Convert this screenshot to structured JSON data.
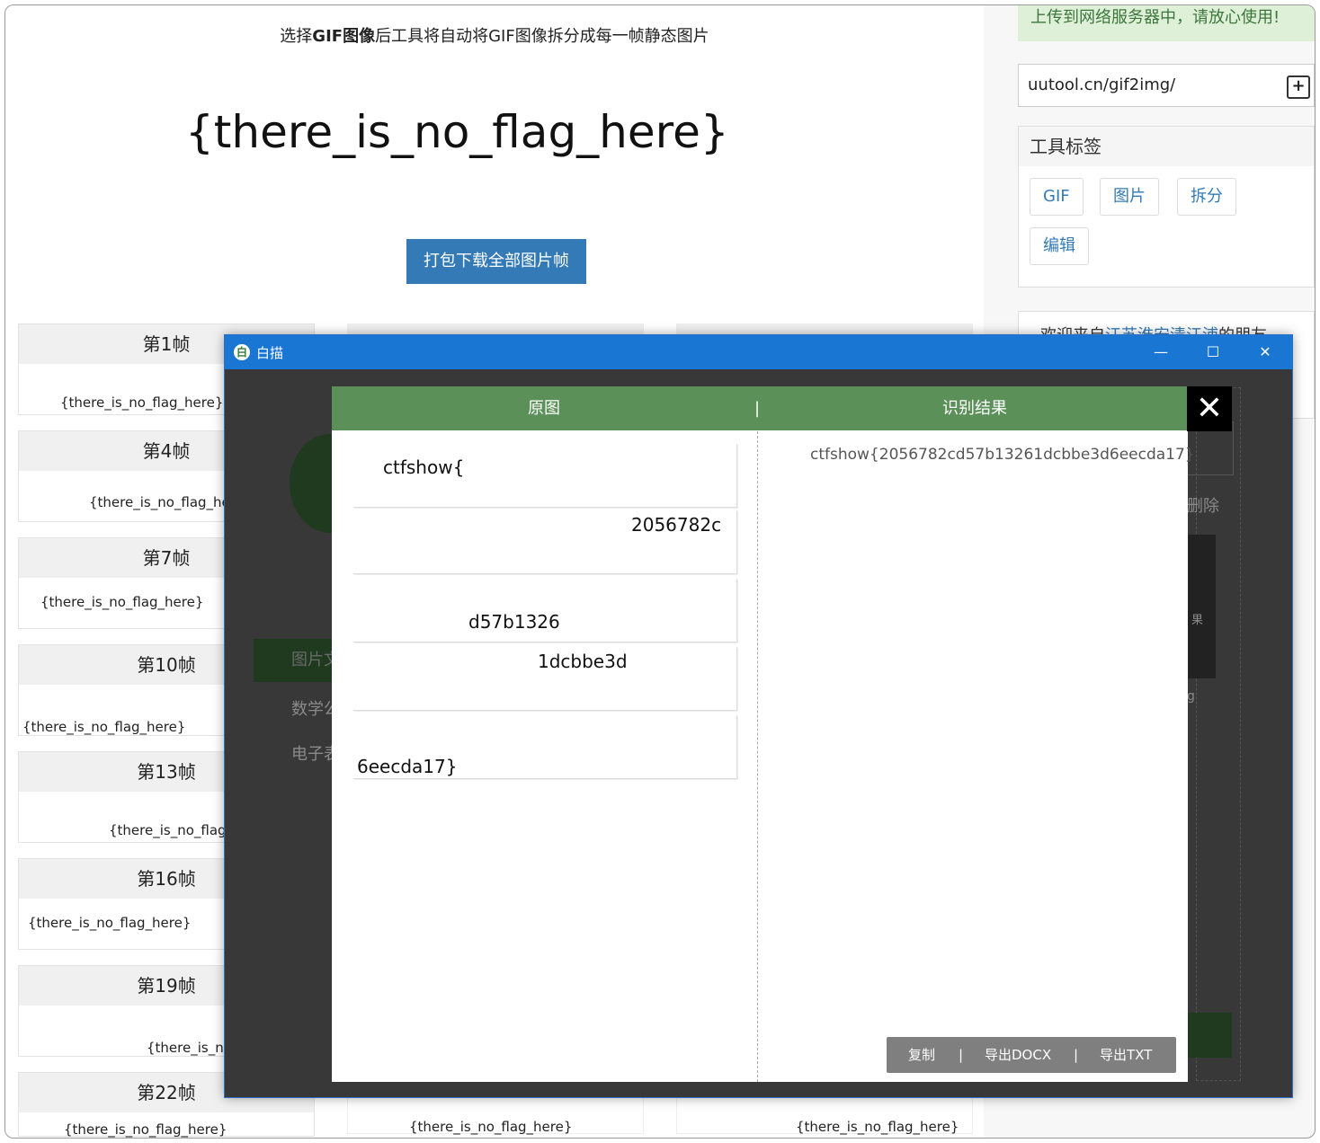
{
  "page": {
    "intro_prefix": "选择",
    "intro_bold": "GIF图像",
    "intro_suffix": "后工具将自动将GIF图像拆分成每一帧静态图片",
    "big_flag": "{there_is_no_flag_here}",
    "download_button": "打包下载全部图片帧",
    "frames": [
      {
        "label": "第1帧",
        "content": "{there_is_no_flag_here}"
      },
      {
        "label": "第4帧",
        "content": "{there_is_no_flag_here}"
      },
      {
        "label": "第7帧",
        "content": "{there_is_no_flag_here}"
      },
      {
        "label": "第10帧",
        "content": "{there_is_no_flag_here}"
      },
      {
        "label": "第13帧",
        "content": "{there_is_no_flag_h"
      },
      {
        "label": "第16帧",
        "content": "{there_is_no_flag_here}"
      },
      {
        "label": "第19帧",
        "content": "{there_is_no_"
      },
      {
        "label": "第22帧",
        "content": "{there_is_no_flag_here}"
      }
    ],
    "bottom_frame_texts": [
      "{there_is_no_flag_here}",
      "{there_is_no_flag_here}"
    ]
  },
  "sidebar": {
    "notice": "上传到网络服务器中，请放心使用!",
    "url": "uutool.cn/gif2img/",
    "tags_title": "工具标签",
    "tags": [
      "GIF",
      "图片",
      "拆分",
      "编辑"
    ],
    "welcome_prefix": "欢迎来自",
    "welcome_link": "江苏淮安清江浦",
    "welcome_suffix": "的朋友"
  },
  "app": {
    "title": "白描",
    "window_controls": [
      "—",
      "☐",
      "✕"
    ],
    "bg_menu": [
      "图片文",
      "数学公",
      "电子表"
    ],
    "bg_side_texts": [
      "删除",
      "果",
      "g"
    ],
    "dialog": {
      "left_header": "原图",
      "separator": "|",
      "right_header": "识别结果",
      "close": "✕",
      "strips": [
        "ctfshow{",
        "2056782c",
        "d57b1326",
        "1dcbbe3d",
        "6eecda17}"
      ],
      "result": "ctfshow{2056782cd57b13261dcbbe3d6eecda17}",
      "actions": {
        "copy": "复制",
        "export_docx": "导出DOCX",
        "export_txt": "导出TXT",
        "sep": "|"
      }
    }
  }
}
